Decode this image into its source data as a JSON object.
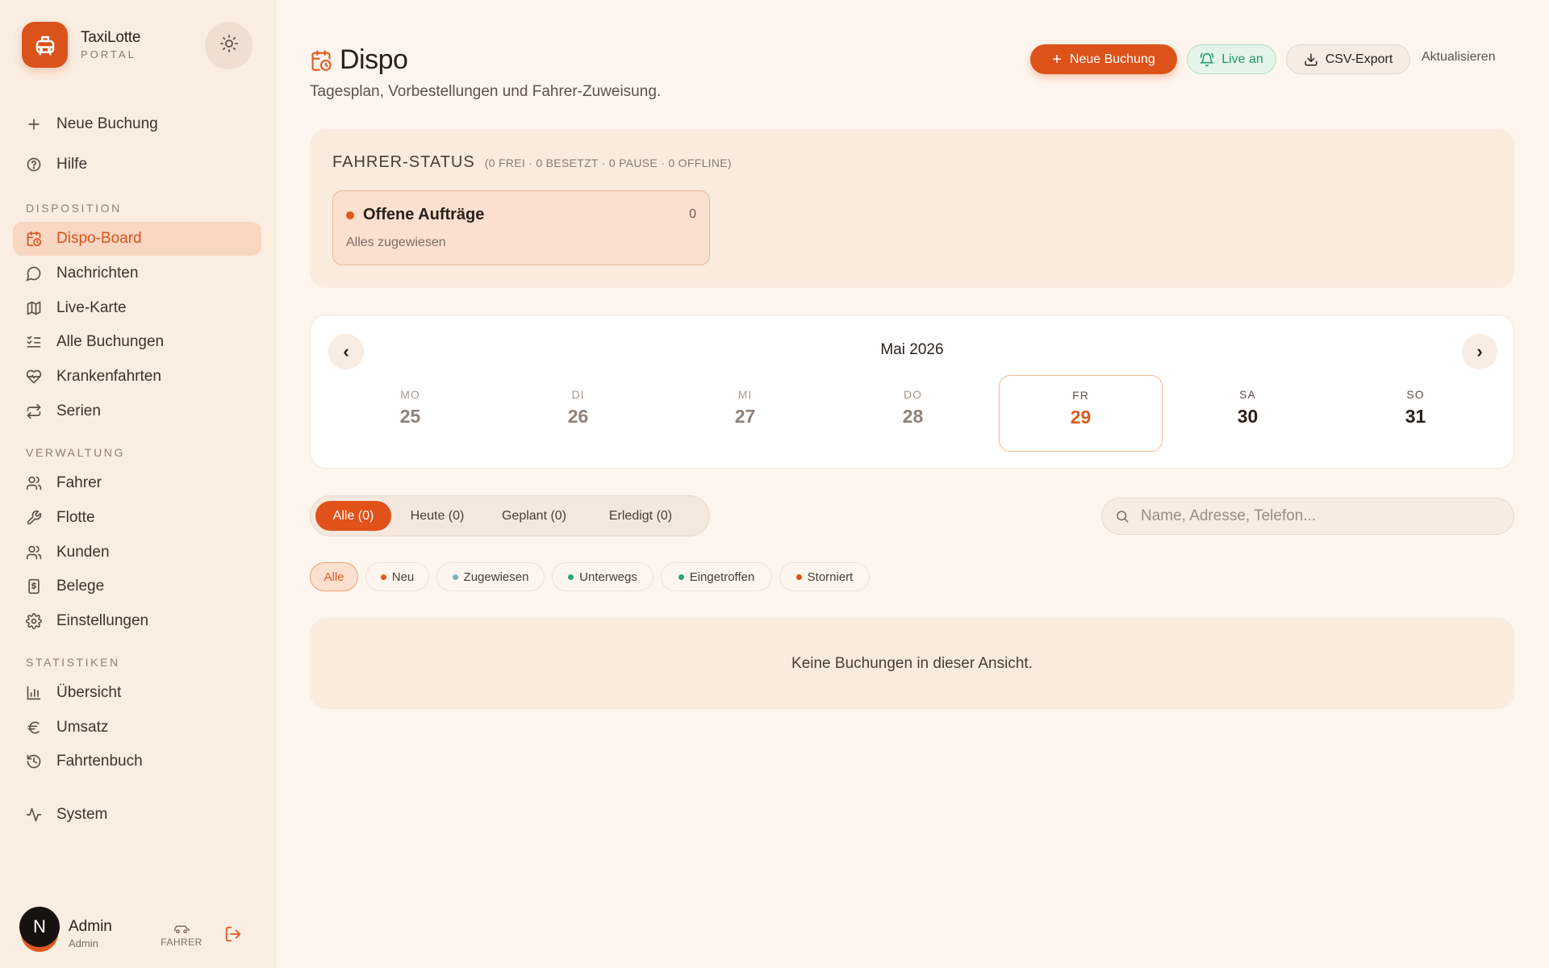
{
  "brand": {
    "name": "TaxiLotte",
    "sub": "PORTAL"
  },
  "sidebar": {
    "top_items": [
      {
        "label": "Neue Buchung",
        "icon": "plus-icon"
      },
      {
        "label": "Hilfe",
        "icon": "help-circle-icon"
      }
    ],
    "sections": [
      {
        "title": "DISPOSITION",
        "items": [
          {
            "label": "Dispo-Board",
            "icon": "calendar-clock-icon",
            "active": true
          },
          {
            "label": "Nachrichten",
            "icon": "message-icon"
          },
          {
            "label": "Live-Karte",
            "icon": "map-icon"
          },
          {
            "label": "Alle Buchungen",
            "icon": "list-checks-icon"
          },
          {
            "label": "Krankenfahrten",
            "icon": "heart-pulse-icon"
          },
          {
            "label": "Serien",
            "icon": "repeat-icon"
          }
        ]
      },
      {
        "title": "VERWALTUNG",
        "items": [
          {
            "label": "Fahrer",
            "icon": "users-icon"
          },
          {
            "label": "Flotte",
            "icon": "wrench-icon"
          },
          {
            "label": "Kunden",
            "icon": "users-icon"
          },
          {
            "label": "Belege",
            "icon": "receipt-icon"
          },
          {
            "label": "Einstellungen",
            "icon": "gear-icon"
          }
        ]
      },
      {
        "title": "STATISTIKEN",
        "items": [
          {
            "label": "Übersicht",
            "icon": "bar-chart-icon"
          },
          {
            "label": "Umsatz",
            "icon": "euro-icon"
          },
          {
            "label": "Fahrtenbuch",
            "icon": "history-icon"
          }
        ]
      }
    ],
    "system_item": {
      "label": "System",
      "icon": "activity-icon"
    },
    "user": {
      "initial": "N",
      "name": "Admin",
      "role": "Admin",
      "driver_label": "FAHRER"
    }
  },
  "header": {
    "title": "Dispo",
    "subtitle": "Tagesplan, Vorbestellungen und Fahrer-Zuweisung.",
    "new_booking": "Neue Buchung",
    "live": "Live an",
    "csv": "CSV-Export",
    "refresh": "Aktualisieren"
  },
  "driver_status": {
    "title": "FAHRER-STATUS",
    "meta": "(0 FREI · 0 BESETZT · 0 PAUSE · 0 OFFLINE)",
    "open_title": "Offene Aufträge",
    "open_count": "0",
    "open_sub": "Alles zugewiesen"
  },
  "calendar": {
    "month": "Mai 2026",
    "prev": "‹",
    "next": "›",
    "days": [
      {
        "dow": "MO",
        "num": "25",
        "state": "past"
      },
      {
        "dow": "DI",
        "num": "26",
        "state": "past"
      },
      {
        "dow": "MI",
        "num": "27",
        "state": "past"
      },
      {
        "dow": "DO",
        "num": "28",
        "state": "past"
      },
      {
        "dow": "FR",
        "num": "29",
        "state": "selected"
      },
      {
        "dow": "SA",
        "num": "30",
        "state": "future"
      },
      {
        "dow": "SO",
        "num": "31",
        "state": "future"
      }
    ]
  },
  "filters": {
    "tabs": [
      {
        "label": "Alle (0)",
        "active": true
      },
      {
        "label": "Heute (0)"
      },
      {
        "label": "Geplant (0)"
      },
      {
        "label": "Erledigt (0)"
      }
    ],
    "search_placeholder": "Name, Adresse, Telefon...",
    "status_chips": [
      {
        "label": "Alle",
        "active": true
      },
      {
        "label": "Neu",
        "color": "#e05a1f"
      },
      {
        "label": "Zugewiesen",
        "color": "#6fb3c8"
      },
      {
        "label": "Unterwegs",
        "color": "#2aa57a"
      },
      {
        "label": "Eingetroffen",
        "color": "#2aa57a"
      },
      {
        "label": "Storniert",
        "color": "#d9531b"
      }
    ]
  },
  "empty": "Keine Buchungen in dieser Ansicht.",
  "colors": {
    "accent": "#dd5219",
    "live": "#1f9a68",
    "sidebar_bg": "#faede2",
    "page_bg": "#fdf5ee"
  }
}
